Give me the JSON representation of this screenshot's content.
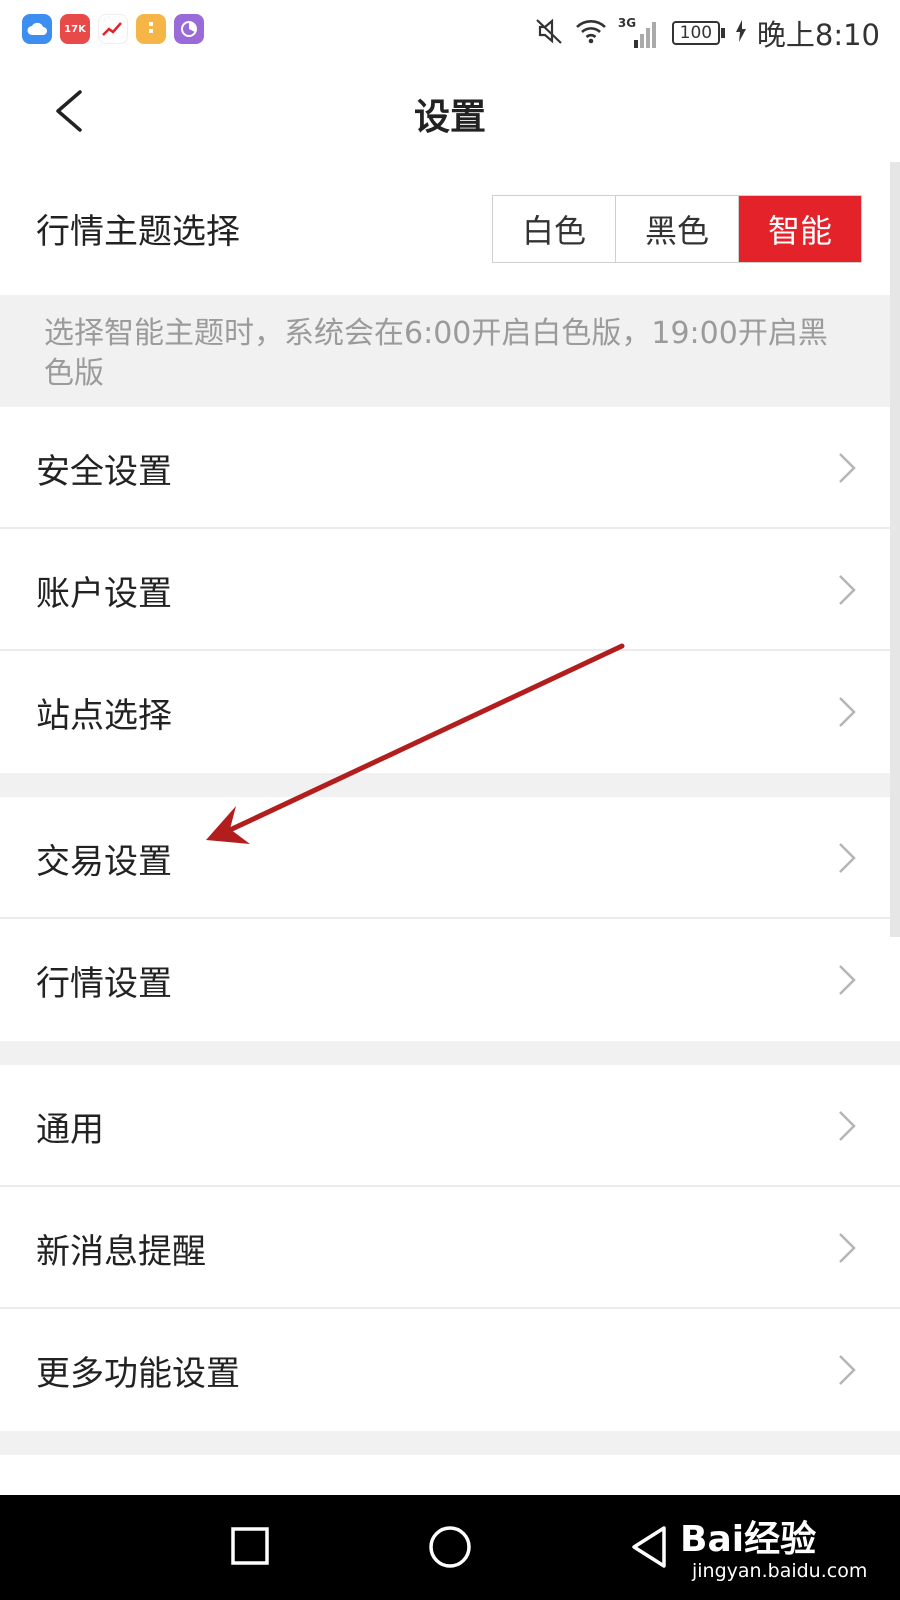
{
  "status_bar": {
    "time": "晚上8:10",
    "battery": "100",
    "network": "3G",
    "notification_icons": [
      "cloud-app-icon",
      "17k-app-icon",
      "stock-app-icon",
      "orange-app-icon",
      "purple-app-icon"
    ],
    "notif_icon_17k_text": "17K"
  },
  "header": {
    "title": "设置"
  },
  "theme": {
    "label": "行情主题选择",
    "options": [
      "白色",
      "黑色",
      "智能"
    ],
    "selected": "智能",
    "hint": "选择智能主题时，系统会在6:00开启白色版，19:00开启黑色版",
    "accent_color": "#e3222a"
  },
  "groups": [
    {
      "items": [
        "安全设置",
        "账户设置",
        "站点选择"
      ]
    },
    {
      "items": [
        "交易设置",
        "行情设置"
      ]
    },
    {
      "items": [
        "通用",
        "新消息提醒",
        "更多功能设置"
      ]
    }
  ],
  "watermark": {
    "main": "Bai经验",
    "sub": "jingyan.baidu.com"
  }
}
